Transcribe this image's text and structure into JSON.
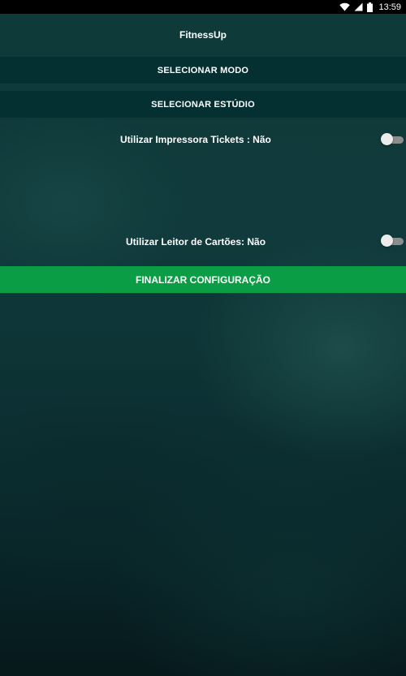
{
  "status_bar": {
    "time": "13:59",
    "icons": [
      "wifi-icon",
      "signal-icon",
      "battery-icon"
    ]
  },
  "app": {
    "title": "FitnessUp"
  },
  "options": {
    "select_mode_label": "SELECIONAR MODO",
    "select_studio_label": "SELECIONAR ESTÚDIO"
  },
  "settings": {
    "printer_label": "Utilizar Impressora Tickets : Não",
    "printer_enabled": false,
    "card_reader_label": "Utilizar Leitor de Cartões: Não",
    "card_reader_enabled": false
  },
  "actions": {
    "finish_label": "FINALIZAR CONFIGURAÇÃO"
  },
  "colors": {
    "status_bar": "#000000",
    "button_background": "#043032",
    "finish_button": "#0a9d45",
    "switch_track_off": "#8d8d8d",
    "switch_thumb_off": "#ececec",
    "text": "#ffffff"
  }
}
